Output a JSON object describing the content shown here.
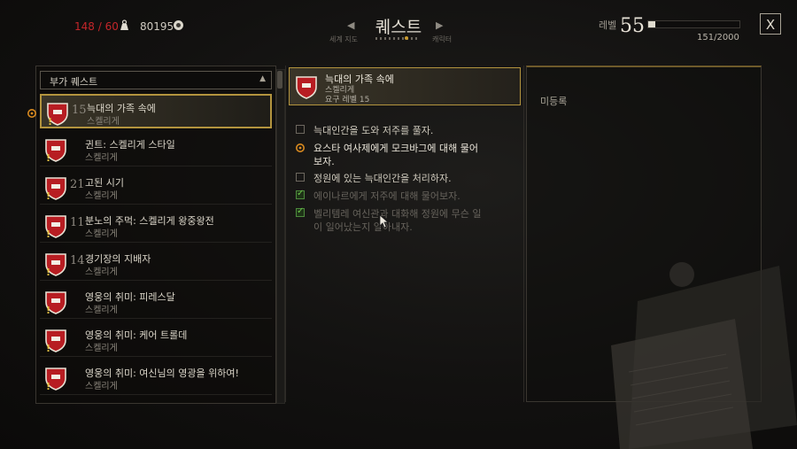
{
  "top_bar": {
    "encumbrance": "148 / 60",
    "money": "80195",
    "title": "퀘스트",
    "nav_left_label": "세계 지도",
    "nav_right_label": "캐릭터",
    "level_label": "레벨",
    "level": "55",
    "xp_text": "151/2000",
    "xp_fraction": 0.0755,
    "close_label": "X"
  },
  "quest_list": {
    "filter_label": "부가 퀘스트",
    "items": [
      {
        "level": "15",
        "name": "늑대의 가족 속에",
        "region": "스켈리게",
        "selected": true
      },
      {
        "level": "",
        "name": "귄트: 스켈리게 스타일",
        "region": "스켈리게",
        "selected": false
      },
      {
        "level": "21",
        "name": "고된 시기",
        "region": "스켈리게",
        "selected": false
      },
      {
        "level": "11",
        "name": "분노의 주먹: 스켈리게 왕중왕전",
        "region": "스켈리게",
        "selected": false
      },
      {
        "level": "14",
        "name": "경기장의 지배자",
        "region": "스켈리게",
        "selected": false
      },
      {
        "level": "",
        "name": "영웅의 취미: 피레스달",
        "region": "스켈리게",
        "selected": false
      },
      {
        "level": "",
        "name": "영웅의 취미: 케어 트롤데",
        "region": "스켈리게",
        "selected": false
      },
      {
        "level": "",
        "name": "영웅의 취미: 여신님의 영광을 위하여!",
        "region": "스켈리게",
        "selected": false
      }
    ]
  },
  "quest_detail": {
    "name": "늑대의 가족 속에",
    "region": "스켈리게",
    "required_level": "요구 레벨 15",
    "objectives": [
      {
        "text": "늑대인간을 도와 저주를 풀자.",
        "state": "open"
      },
      {
        "text": "요스타 여사제에게 모크바그에 대해 물어보자.",
        "state": "active"
      },
      {
        "text": "정원에 있는 늑대인간을 처리하자.",
        "state": "open"
      },
      {
        "text": "에이나르에게 저주에 대해 물어보자.",
        "state": "done"
      },
      {
        "text": "벨리템레 여신관과 대화해 정원에 무슨 일이 일어났는지 알아내자.",
        "state": "done"
      }
    ]
  },
  "right_panel": {
    "status": "미등록"
  },
  "colors": {
    "accent_gold": "#b3943e",
    "encumbrance_red": "#c4262a",
    "complete_green": "#6dc54a"
  }
}
